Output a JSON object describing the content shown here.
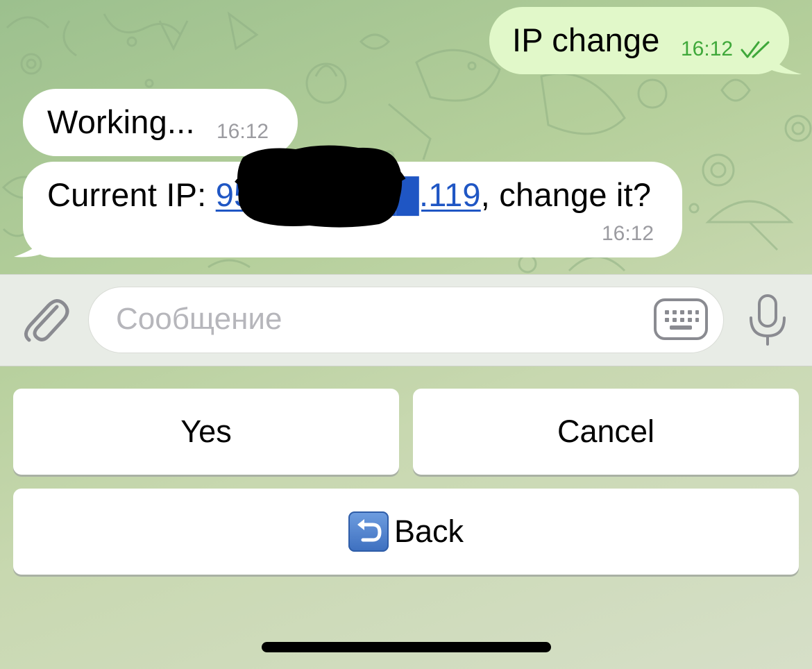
{
  "messages": [
    {
      "direction": "outgoing",
      "text": "IP change",
      "time": "16:12",
      "status": "read"
    },
    {
      "direction": "incoming",
      "text": "Working...",
      "time": "16:12"
    },
    {
      "direction": "incoming",
      "text_prefix": "Current IP: ",
      "link_text": "95.1██████.119",
      "text_suffix": ", change it?",
      "time": "16:12"
    }
  ],
  "composer": {
    "placeholder": "Сообщение",
    "icons": [
      "paperclip-icon",
      "keyboard-icon",
      "microphone-icon"
    ]
  },
  "reply_keyboard": {
    "rows": [
      [
        {
          "label": "Yes"
        },
        {
          "label": "Cancel"
        }
      ],
      [
        {
          "emoji": "back-arrow-emoji",
          "label": "Back"
        }
      ]
    ]
  },
  "colors": {
    "outgoing_bubble": "#e1f8c9",
    "incoming_bubble": "#ffffff",
    "link": "#1f56c4",
    "read_check": "#3fa83a"
  }
}
